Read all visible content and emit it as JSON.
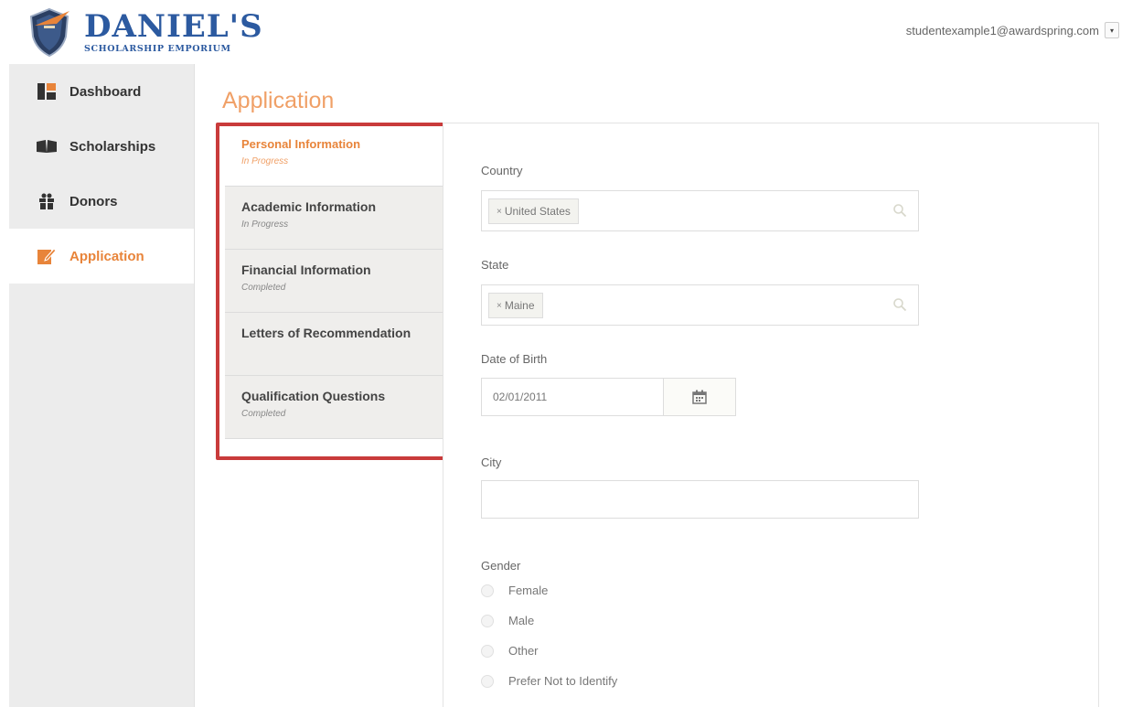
{
  "brand": {
    "name": "DANIEL'S",
    "subtitle": "SCHOLARSHIP EMPORIUM"
  },
  "user": {
    "email": "studentexample1@awardspring.com",
    "caret": "▾"
  },
  "nav": {
    "items": [
      {
        "label": "Dashboard",
        "icon": "dashboard-icon"
      },
      {
        "label": "Scholarships",
        "icon": "book-icon"
      },
      {
        "label": "Donors",
        "icon": "gift-icon"
      },
      {
        "label": "Application",
        "icon": "edit-icon",
        "active": true
      }
    ]
  },
  "page": {
    "title": "Application"
  },
  "steps": [
    {
      "title": "Personal Information",
      "status": "In Progress"
    },
    {
      "title": "Academic Information",
      "status": "In Progress"
    },
    {
      "title": "Financial Information",
      "status": "Completed"
    },
    {
      "title": "Letters of Recommendation",
      "status": ""
    },
    {
      "title": "Qualification Questions",
      "status": "Completed"
    }
  ],
  "form": {
    "country": {
      "label": "Country",
      "value": "United States",
      "remove": "×"
    },
    "state": {
      "label": "State",
      "value": "Maine",
      "remove": "×"
    },
    "dob": {
      "label": "Date of Birth",
      "value": "02/01/2011"
    },
    "city": {
      "label": "City",
      "value": ""
    },
    "gender": {
      "label": "Gender",
      "options": [
        "Female",
        "Male",
        "Other",
        "Prefer Not to Identify"
      ]
    }
  },
  "colors": {
    "accent": "#e8843a",
    "brand": "#2c5aa0",
    "highlight": "#c93b3b"
  }
}
